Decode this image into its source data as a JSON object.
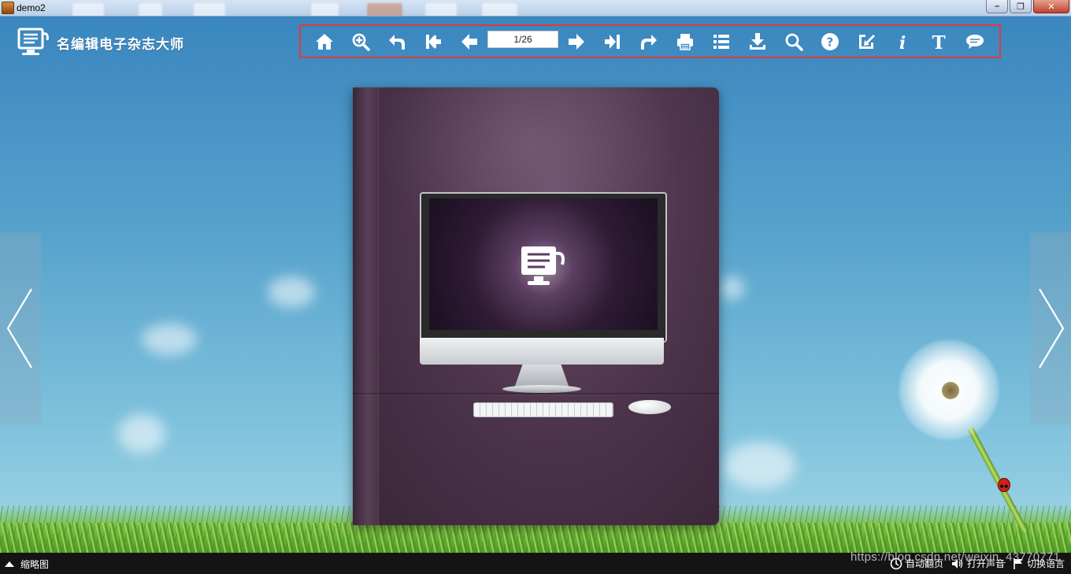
{
  "window": {
    "title": "demo2",
    "controls": {
      "minimize": "–",
      "restore": "❐",
      "close": "✕"
    }
  },
  "app": {
    "logo_text": "名编辑电子杂志大师"
  },
  "toolbar": {
    "page_indicator": "1/26",
    "buttons": [
      {
        "name": "home",
        "icon": "home-icon"
      },
      {
        "name": "zoom-in",
        "icon": "zoom-in-icon"
      },
      {
        "name": "back",
        "icon": "undo-arrow-icon"
      },
      {
        "name": "first-page",
        "icon": "first-page-icon"
      },
      {
        "name": "previous-page",
        "icon": "arrow-left-icon"
      },
      {
        "name": "next-page",
        "icon": "arrow-right-icon"
      },
      {
        "name": "last-page",
        "icon": "last-page-icon"
      },
      {
        "name": "share",
        "icon": "redo-arrow-icon"
      },
      {
        "name": "print",
        "icon": "printer-icon"
      },
      {
        "name": "table-of-contents",
        "icon": "list-icon"
      },
      {
        "name": "download",
        "icon": "download-icon"
      },
      {
        "name": "search",
        "icon": "search-icon"
      },
      {
        "name": "help",
        "icon": "help-icon"
      },
      {
        "name": "export",
        "icon": "export-icon"
      },
      {
        "name": "info",
        "icon": "info-icon"
      },
      {
        "name": "text",
        "icon": "text-icon"
      },
      {
        "name": "comments",
        "icon": "comment-icon"
      }
    ]
  },
  "bottom_bar": {
    "thumbnails_label": "缩略图",
    "auto_flip_label": "自动翻页",
    "sound_label": "打开声音",
    "language_label": "切换语言"
  },
  "watermark": "https://blog.csdn.net/weixin_43770771",
  "colors": {
    "toolbar_highlight": "#e03a3a",
    "book_cover": "#4a3248",
    "bottom_bar": "#141414"
  }
}
